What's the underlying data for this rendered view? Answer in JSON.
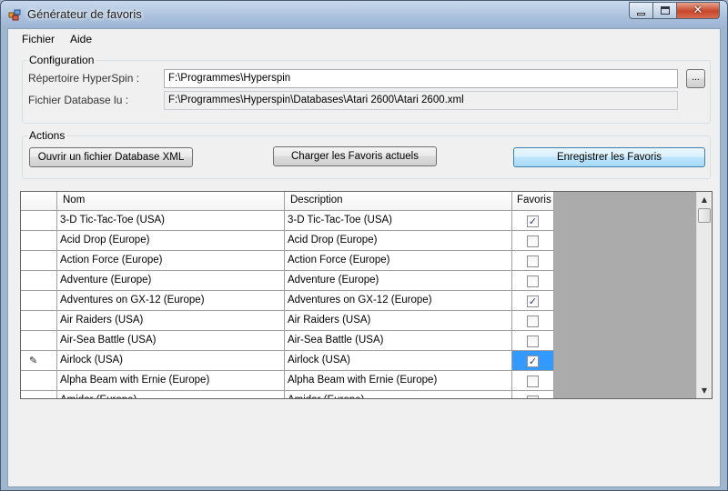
{
  "window": {
    "title": "Générateur de favoris",
    "close_glyph": "✕"
  },
  "menu": {
    "fichier": "Fichier",
    "aide": "Aide"
  },
  "config": {
    "group_label": "Configuration",
    "hyperspin_label": "Répertoire HyperSpin :",
    "hyperspin_value": "F:\\Programmes\\Hyperspin",
    "browse_label": "...",
    "database_label": "Fichier Database lu :",
    "database_value": "F:\\Programmes\\Hyperspin\\Databases\\Atari 2600\\Atari 2600.xml"
  },
  "actions": {
    "group_label": "Actions",
    "open_db": "Ouvrir un fichier Database XML",
    "load_favs": "Charger les Favoris actuels",
    "save_favs": "Enregistrer les Favoris"
  },
  "grid": {
    "headers": {
      "nom": "Nom",
      "description": "Description",
      "favoris": "Favoris"
    },
    "rows": [
      {
        "nom": "3-D Tic-Tac-Toe (USA)",
        "description": "3-D Tic-Tac-Toe (USA)",
        "favori": true
      },
      {
        "nom": "Acid Drop (Europe)",
        "description": "Acid Drop (Europe)",
        "favori": false
      },
      {
        "nom": "Action Force (Europe)",
        "description": "Action Force (Europe)",
        "favori": false
      },
      {
        "nom": "Adventure (Europe)",
        "description": "Adventure (Europe)",
        "favori": false
      },
      {
        "nom": "Adventures on GX-12 (Europe)",
        "description": "Adventures on GX-12 (Europe)",
        "favori": true
      },
      {
        "nom": "Air Raiders (USA)",
        "description": "Air Raiders (USA)",
        "favori": false
      },
      {
        "nom": "Air-Sea Battle (USA)",
        "description": "Air-Sea Battle (USA)",
        "favori": false
      },
      {
        "nom": "Airlock (USA)",
        "description": "Airlock (USA)",
        "favori": true,
        "editing": true
      },
      {
        "nom": "Alpha Beam with Ernie (Europe)",
        "description": "Alpha Beam with Ernie (Europe)",
        "favori": false
      },
      {
        "nom": "Amidar (Europe)",
        "description": "Amidar (Europe)",
        "favori": false
      }
    ],
    "check_glyph": "✓",
    "edit_glyph": "✎"
  },
  "scrollbar": {
    "up_glyph": "▲",
    "down_glyph": "▼"
  },
  "colors": {
    "selection": "#3399ff",
    "grid_background": "#ababab"
  }
}
